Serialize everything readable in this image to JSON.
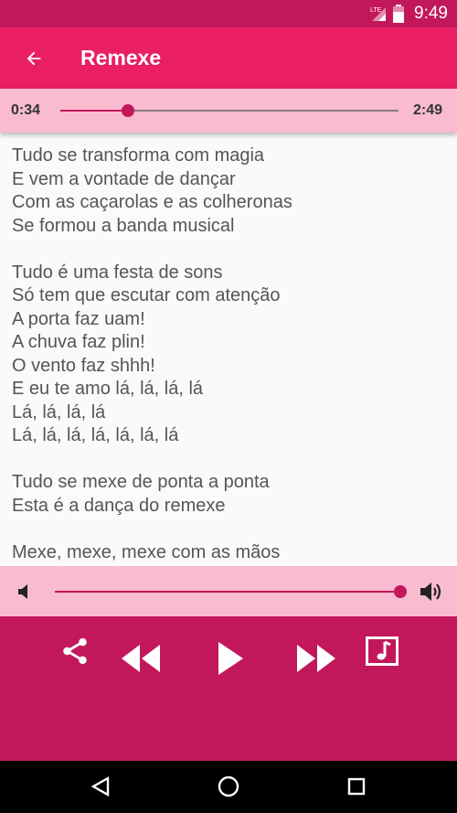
{
  "status_bar": {
    "network": "LTE",
    "time": "9:49"
  },
  "app_bar": {
    "title": "Remexe"
  },
  "seek": {
    "current": "0:34",
    "duration": "2:49",
    "progress": 0.2
  },
  "lyrics": [
    [
      "Tudo se transforma com magia",
      "E vem a vontade de dançar",
      "Com as caçarolas e as colheronas",
      "Se formou a banda musical"
    ],
    [
      "Tudo é uma festa de sons",
      "Só tem que escutar com atenção",
      "A porta faz uam!",
      "A chuva faz plin!",
      "O vento faz shhh!",
      "E eu te amo lá, lá, lá, lá",
      "Lá, lá, lá, lá",
      "Lá, lá, lá, lá, lá, lá, lá"
    ],
    [
      "Tudo se mexe de ponta a ponta",
      "Esta é a dança do remexe"
    ],
    [
      "Mexe, mexe, mexe com as mãos"
    ]
  ],
  "volume": {
    "level": 1.0
  },
  "controls": [
    "share-icon",
    "rewind-icon",
    "play-icon",
    "fast-forward-icon",
    "music-note-icon"
  ],
  "colors": {
    "primary": "#e91e63",
    "primary_dark": "#c2185b",
    "light": "#f8bbd0"
  }
}
